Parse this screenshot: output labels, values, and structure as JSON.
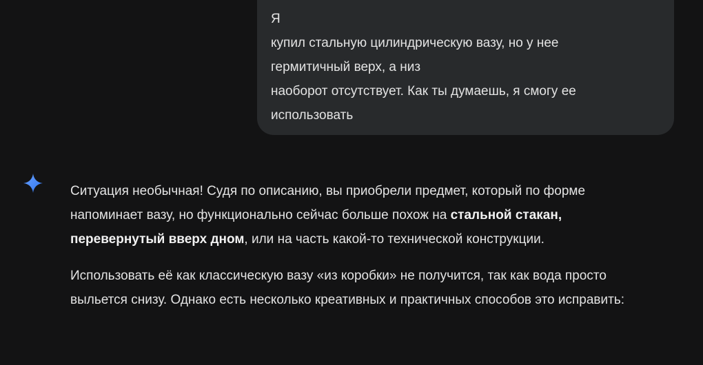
{
  "user_message": {
    "lines": [
      "Я",
      "купил стальную цилиндрическую вазу, но у нее",
      "гермитичный верх, а низ",
      "наоборот отсутствует. Как ты думаешь, я смогу ее",
      "использовать"
    ]
  },
  "assistant": {
    "icon": "gemini-sparkle-icon",
    "accent_color": "#4b8df8",
    "paragraph1": {
      "part1": "Ситуация необычная! Судя по описанию, вы приобрели предмет, который по форме напоминает вазу, но функционально сейчас больше похож на ",
      "bold1": "стальной стакан, перевернутый вверх дном",
      "part2": ", или на часть какой-то технической конструкции."
    },
    "paragraph2": "Использовать её как классическую вазу «из коробки» не получится, так как вода просто выльется снизу. Однако есть несколько креативных и практичных способов это исправить:"
  }
}
